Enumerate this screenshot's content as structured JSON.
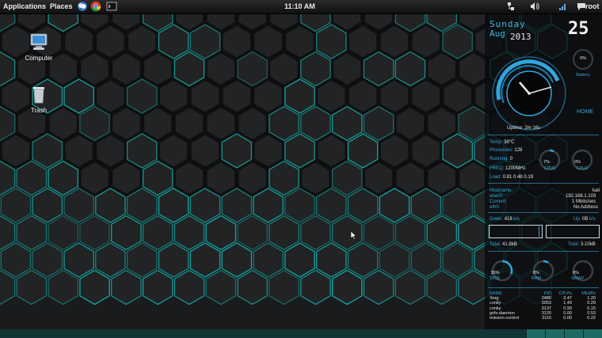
{
  "topbar": {
    "applications": "Applications",
    "places": "Places",
    "clock": "11:10 AM",
    "user": "root",
    "launchers": [
      "weather-icon",
      "chrome-icon",
      "terminal-icon"
    ],
    "indicators": [
      "network-icon",
      "volume-icon",
      "signal-icon",
      "chat-icon"
    ]
  },
  "desktop": {
    "icons": [
      {
        "label": "Computer",
        "icon": "computer-icon"
      },
      {
        "label": "Trash",
        "icon": "trash-icon"
      }
    ]
  },
  "conky": {
    "day": "Sunday",
    "month": "Aug",
    "year": "2013",
    "date": "25",
    "battery_label": "Battery",
    "battery_value": "0%",
    "home_label": "HOME",
    "uptime": "Uptime: 2m 16s",
    "system": {
      "temp_label": "Temp:",
      "temp_value": "39°C",
      "processes_label": "Processes:",
      "processes_value": "128",
      "running_label": "Running:",
      "running_value": "0",
      "freq_label": "FREQ:",
      "freq_value": "1200MHz",
      "load_label": "Load:",
      "load_value": "0.81 0.48 0.19"
    },
    "cpu1": {
      "label": "CPU1",
      "value": "7%",
      "fraction": 0.07
    },
    "cpu2": {
      "label": "CPU2",
      "value": "0%",
      "fraction": 0.0
    },
    "network": {
      "hostname_label": "Hostname:",
      "hostname_value": "kali",
      "wlan_label": "wlan0:",
      "wlan_value": "192.168.1.103",
      "current_label": "Current:",
      "current_value": "1 Mbits/sec",
      "eth_label": "eth0:",
      "eth_value": "No Address",
      "down_label": "Down: ",
      "down_value": "418",
      "up_label": "Up: ",
      "up_value": "0B",
      "rate_unit": "k/s",
      "total_down_label": "Total:",
      "total_down_value": "41.8kB",
      "total_up_label": "Total:",
      "total_up_value": "3.10kB"
    },
    "disk": {
      "label": "DISK",
      "value": "30%",
      "fraction": 0.3
    },
    "ram": {
      "label": "RAM",
      "value": "8%",
      "fraction": 0.08
    },
    "swap": {
      "label": "SWAP",
      "value": "0%",
      "fraction": 0.0
    },
    "process_table": {
      "headers": [
        "NAME",
        "PID",
        "CPU%",
        "MEM%"
      ],
      "rows": [
        [
          "Xorg",
          "2480",
          "3.47",
          "1.20"
        ],
        [
          "conky",
          "3053",
          "1.49",
          "0.29"
        ],
        [
          "conky",
          "3137",
          "0.99",
          "0.15"
        ],
        [
          "gvfs-daemon",
          "3120",
          "0.00",
          "0.53"
        ],
        [
          "mission-control",
          "3116",
          "0.00",
          "0.22"
        ]
      ]
    }
  },
  "colors": {
    "accent": "#3aa8d8",
    "hex_glow": "#13c9c4",
    "background": "#1a1b1c"
  }
}
